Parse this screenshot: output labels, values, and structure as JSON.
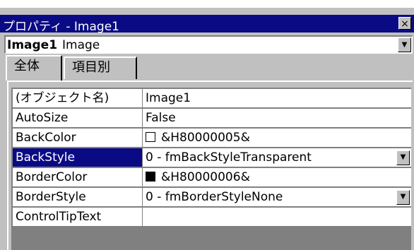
{
  "window": {
    "title": "プロパティ - Image1",
    "close_label": "×"
  },
  "object_selector": {
    "name": "Image1",
    "type": "Image",
    "dropdown_glyph": "▼"
  },
  "tabs": [
    {
      "label": "全体",
      "active": true
    },
    {
      "label": "項目別",
      "active": false
    }
  ],
  "properties": [
    {
      "name": "(オブジェクト名)",
      "value": "Image1"
    },
    {
      "name": "AutoSize",
      "value": "False"
    },
    {
      "name": "BackColor",
      "value": "&H80000005&",
      "swatch": "#ffffff"
    },
    {
      "name": "BackStyle",
      "value": "0 - fmBackStyleTransparent",
      "selected": true,
      "dropdown": true
    },
    {
      "name": "BorderColor",
      "value": "&H80000006&",
      "swatch": "#000000"
    },
    {
      "name": "BorderStyle",
      "value": "0 - fmBorderStyleNone",
      "dropdown": true
    },
    {
      "name": "ControlTipText",
      "value": ""
    }
  ],
  "colors": {
    "titlebar": "#0a0a85",
    "face": "#c0c0c0",
    "selection": "#0a0a85"
  }
}
